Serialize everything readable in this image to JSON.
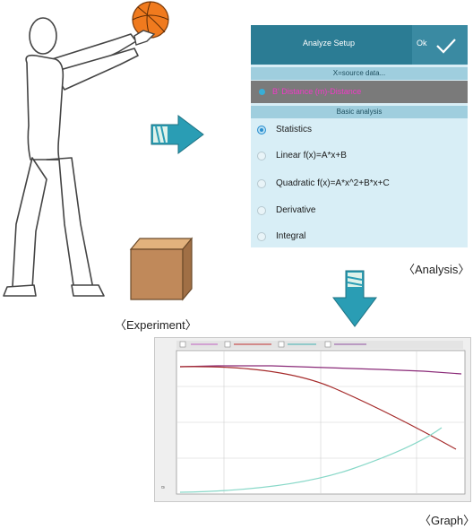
{
  "analysis": {
    "title": "Analyze Setup",
    "ok_label": "Ok",
    "section_source": "X=source data...",
    "source_item": "B' Distance (m)-Distance",
    "section_basic": "Basic analysis",
    "options": [
      {
        "label": "Statistics",
        "selected": true
      },
      {
        "label": "Linear f(x)=A*x+B",
        "selected": false
      },
      {
        "label": "Quadratic f(x)=A*x^2+B*x+C",
        "selected": false
      },
      {
        "label": "Derivative",
        "selected": false
      },
      {
        "label": "Integral",
        "selected": false
      }
    ]
  },
  "captions": {
    "analysis": "〈Analysis〉",
    "experiment": "〈Experiment〉",
    "graph": "〈Graph〉"
  },
  "colors": {
    "header": "#2b7c94",
    "panel": "#d8eef6",
    "arrow": "#2a9db4",
    "ball": "#f07a1e",
    "box": "#c0895a",
    "curve_total": "#8a2a78",
    "curve_potential": "#a52a2a",
    "curve_kinetic": "#88d8c8"
  },
  "icons": [
    "check-icon",
    "arrow-right-icon",
    "arrow-down-icon"
  ]
}
